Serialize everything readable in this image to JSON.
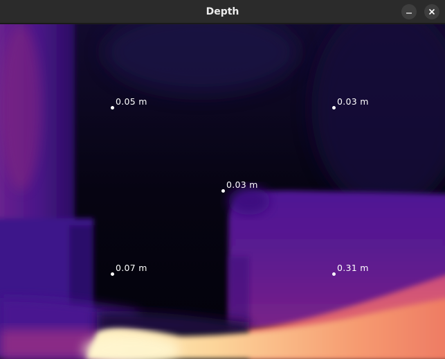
{
  "window": {
    "title": "Depth"
  },
  "titlebar": {
    "minimize_icon": "minimize-icon",
    "close_icon": "close-icon"
  },
  "depth_view": {
    "colormap": "magma",
    "measurements": [
      {
        "id": "top-left",
        "label": "0.05 m"
      },
      {
        "id": "top-right",
        "label": "0.03 m"
      },
      {
        "id": "center",
        "label": "0.03 m"
      },
      {
        "id": "bottom-left",
        "label": "0.07 m"
      },
      {
        "id": "bottom-right",
        "label": "0.31 m"
      }
    ]
  }
}
